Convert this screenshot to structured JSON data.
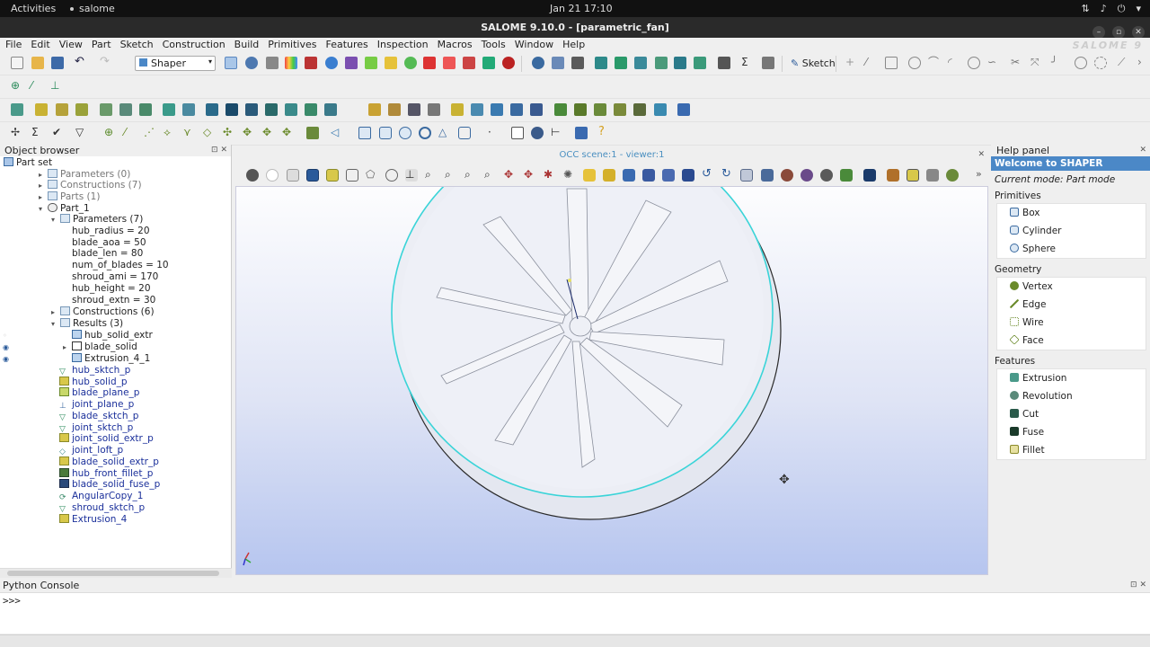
{
  "system_bar": {
    "activities": "Activities",
    "app": "salome",
    "clock": "Jan 21  17:10"
  },
  "window": {
    "title": "SALOME 9.10.0 - [parametric_fan]",
    "logo": "SALOME 9"
  },
  "menu": [
    "File",
    "Edit",
    "View",
    "Part",
    "Sketch",
    "Construction",
    "Build",
    "Primitives",
    "Features",
    "Inspection",
    "Macros",
    "Tools",
    "Window",
    "Help"
  ],
  "toolbar": {
    "module_select": "Shaper",
    "sketch_label": "Sketch"
  },
  "object_browser": {
    "title": "Object browser",
    "part_set": "Part set",
    "parameters": "Parameters (0)",
    "constructions": "Constructions (7)",
    "parts": "Parts (1)",
    "part1": "Part_1",
    "part_parameters": "Parameters (7)",
    "params": [
      "hub_radius = 20",
      "blade_aoa = 50",
      "blade_len = 80",
      "num_of_blades = 10",
      "shroud_ami = 170",
      "hub_height = 20",
      "shroud_extn = 30"
    ],
    "part_constructions": "Constructions (6)",
    "results": "Results (3)",
    "results_items": [
      "hub_solid_extr",
      "blade_solid",
      "Extrusion_4_1"
    ],
    "features": [
      "hub_sktch_p",
      "hub_solid_p",
      "blade_plane_p",
      "joint_plane_p",
      "blade_sktch_p",
      "joint_sktch_p",
      "joint_solid_extr_p",
      "joint_loft_p",
      "blade_solid_extr_p",
      "hub_front_fillet_p",
      "blade_solid_fuse_p",
      "AngularCopy_1",
      "shroud_sktch_p",
      "Extrusion_4"
    ]
  },
  "viewer": {
    "title": "OCC scene:1 - viewer:1"
  },
  "help_panel": {
    "title": "Help panel",
    "welcome": "Welcome to SHAPER",
    "mode": "Current mode: Part mode",
    "primitives_title": "Primitives",
    "primitives": [
      "Box",
      "Cylinder",
      "Sphere"
    ],
    "geometry_title": "Geometry",
    "geometry": [
      "Vertex",
      "Edge",
      "Wire",
      "Face"
    ],
    "features_title": "Features",
    "features": [
      "Extrusion",
      "Revolution",
      "Cut",
      "Fuse",
      "Fillet"
    ]
  },
  "python_console": {
    "title": "Python Console",
    "prompt": ">>>"
  },
  "colors": {
    "accent": "#4b88c7",
    "shroud_edge": "#3ad4d8",
    "tree_link": "#1a2f9a"
  }
}
